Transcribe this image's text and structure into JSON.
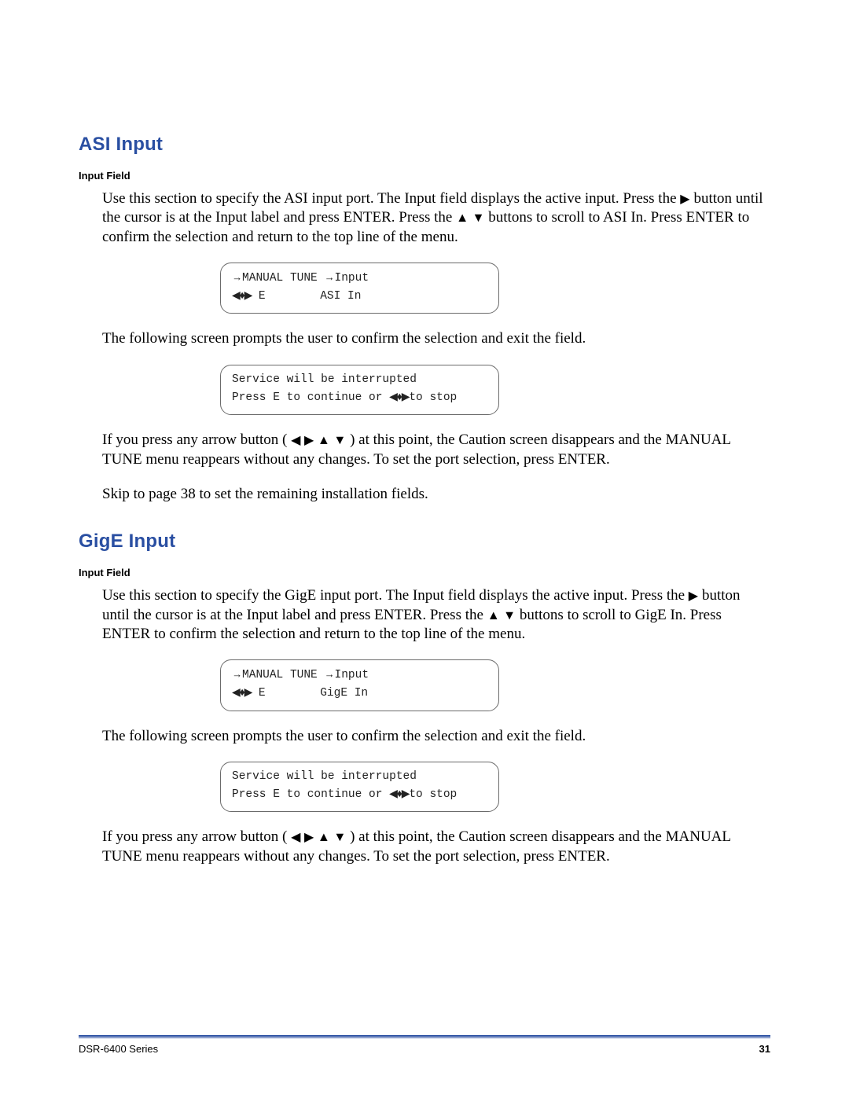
{
  "sections": {
    "asi": {
      "heading": "ASI Input",
      "subhead": "Input Field",
      "para1_a": "Use this section to specify the ASI input port. The Input field displays the active input. Press the ",
      "para1_b": " button until the cursor is at the Input label and press ENTER. Press the ",
      "para1_c": " buttons to scroll to ASI In. Press ENTER to confirm the selection and return to the top line of the menu.",
      "lcd1_line1_a": "MANUAL TUNE ",
      "lcd1_line1_b": "Input",
      "lcd1_line2_a": " E        ASI In",
      "para2": "The following screen prompts the user to confirm the selection and exit the field.",
      "lcd2_line1": "Service will be interrupted",
      "lcd2_line2_a": "Press E to continue or ",
      "lcd2_line2_b": "to stop",
      "para3_a": "If you press any arrow button ( ",
      "para3_b": " ) at this point, the Caution screen disappears and the MANUAL TUNE menu reappears without any changes. To set the port selection, press ENTER.",
      "para4": "Skip to page 38 to set the remaining installation fields."
    },
    "gige": {
      "heading": "GigE Input",
      "subhead": "Input Field",
      "para1_a": "Use this section to specify the GigE input port. The Input field displays the active input. Press the ",
      "para1_b": " button until the cursor is at the Input label and press ENTER. Press the ",
      "para1_c": " buttons to scroll to GigE In. Press ENTER to confirm the selection and return to the top line of the menu.",
      "lcd1_line1_a": "MANUAL TUNE ",
      "lcd1_line1_b": "Input",
      "lcd1_line2_a": " E        GigE In",
      "para2": "The following screen prompts the user to confirm the selection and exit the field.",
      "lcd2_line1": "Service will be interrupted",
      "lcd2_line2_a": "Press E to continue or ",
      "lcd2_line2_b": "to stop",
      "para3_a": "If you press any arrow button ( ",
      "para3_b": " ) at this point, the Caution screen disappears and the MANUAL TUNE menu reappears without any changes. To set the port selection, press ENTER."
    }
  },
  "glyphs": {
    "right": "▶",
    "left": "◀",
    "up": "▲",
    "down": "▼",
    "arrow_right_thin": "→",
    "nav_cluster": "◀✧▶",
    "nav_cluster_compact": "◀♦▶",
    "up_down": "▲  ▼",
    "all_arrows": "◀   ▶   ▲   ▼"
  },
  "footer": {
    "product": "DSR-6400 Series",
    "page": "31"
  }
}
